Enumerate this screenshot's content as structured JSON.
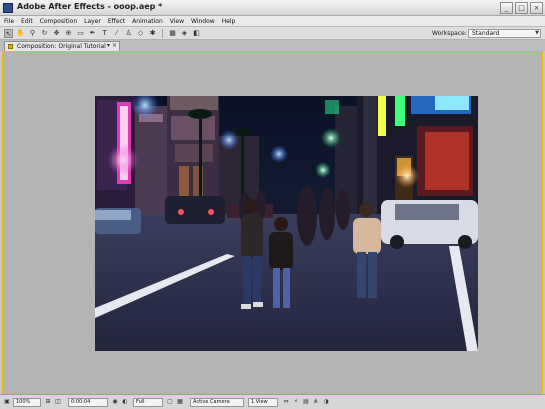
{
  "window": {
    "title": "Adobe After Effects - ooop.aep *",
    "buttons": {
      "minimize": "_",
      "maximize": "□",
      "close": "×"
    }
  },
  "menu": [
    "File",
    "Edit",
    "Composition",
    "Layer",
    "Effect",
    "Animation",
    "View",
    "Window",
    "Help"
  ],
  "toolbar": {
    "tools": [
      {
        "icon": "selection-tool-icon",
        "glyph": "↖",
        "active": true
      },
      {
        "icon": "hand-tool-icon",
        "glyph": "✋"
      },
      {
        "icon": "zoom-tool-icon",
        "glyph": "⚲"
      },
      {
        "icon": "rotation-tool-icon",
        "glyph": "↻"
      },
      {
        "icon": "camera-orbit-tool-icon",
        "glyph": "✥"
      },
      {
        "icon": "pan-behind-tool-icon",
        "glyph": "⊕"
      },
      {
        "icon": "mask-tool-icon",
        "glyph": "▭"
      },
      {
        "icon": "pen-tool-icon",
        "glyph": "✒"
      },
      {
        "icon": "type-tool-icon",
        "glyph": "T"
      },
      {
        "icon": "brush-tool-icon",
        "glyph": "⁄"
      },
      {
        "icon": "clone-stamp-tool-icon",
        "glyph": "♙"
      },
      {
        "icon": "eraser-tool-icon",
        "glyph": "◇"
      },
      {
        "icon": "puppet-tool-icon",
        "glyph": "✱"
      }
    ],
    "axis_icons": [
      "local-axis-icon",
      "world-axis-icon",
      "view-axis-icon"
    ],
    "workspace_label": "Workspace:",
    "workspace_value": "Standard"
  },
  "composition_tab": {
    "label": "Composition: Original Tutorial",
    "menu_glyph": "▾",
    "close_glyph": "×"
  },
  "viewer_bar": {
    "zoom": "100%",
    "timecode": "0:00:04",
    "resolution": "Full",
    "camera": "Active Camera",
    "views": "1 View"
  },
  "colors": {
    "panel_bg": "#b4b4b4",
    "active_panel_border": "#eeb800",
    "chrome": "#d6d6d6"
  }
}
